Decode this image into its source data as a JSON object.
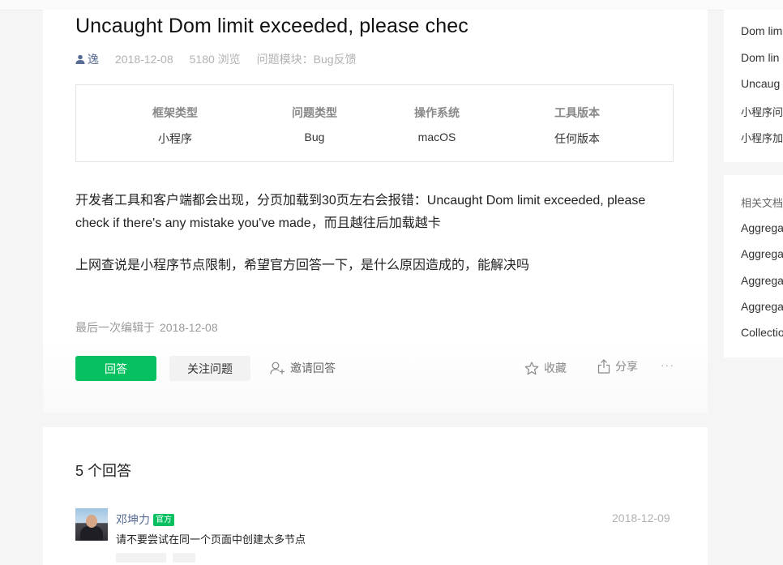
{
  "question": {
    "title": "Uncaught Dom limit exceeded, please chec",
    "author": "逸",
    "date": "2018-12-08",
    "views": "5180 浏览",
    "module_label": "问题模块：",
    "module_value": "Bug反馈",
    "attributes": [
      {
        "key": "框架类型",
        "value": "小程序"
      },
      {
        "key": "问题类型",
        "value": "Bug"
      },
      {
        "key": "操作系统",
        "value": "macOS"
      },
      {
        "key": "工具版本",
        "value": "任何版本"
      }
    ],
    "body": [
      "开发者工具和客户端都会出现，分页加载到30页左右会报错：Uncaught Dom limit exceeded, please check if there's any mistake you've made，而且越往后加载越卡",
      "上网查说是小程序节点限制，希望官方回答一下，是什么原因造成的，能解决吗"
    ],
    "edited_label": "最后一次编辑于",
    "edited_date": "2018-12-08"
  },
  "actions": {
    "answer": "回答",
    "follow": "关注问题",
    "invite": "邀请回答",
    "collect": "收藏",
    "share": "分享",
    "more": "···"
  },
  "answers": {
    "count_label": "5 个回答",
    "items": [
      {
        "name": "邓坤力",
        "badge": "官方",
        "date": "2018-12-09",
        "text": "请不要尝试在同一个页面中创建太多节点"
      }
    ]
  },
  "sidebar": {
    "related_questions": [
      "Dom lim",
      "Dom lin",
      "Uncaug",
      "小程序问",
      "小程序加"
    ],
    "docs_title": "相关文档",
    "docs": [
      "Aggrega",
      "Aggrega",
      "Aggrega",
      "Aggrega",
      "Collectio"
    ]
  },
  "colors": {
    "accent": "#07c160",
    "link": "#576b95",
    "muted": "#b2b2b2"
  }
}
